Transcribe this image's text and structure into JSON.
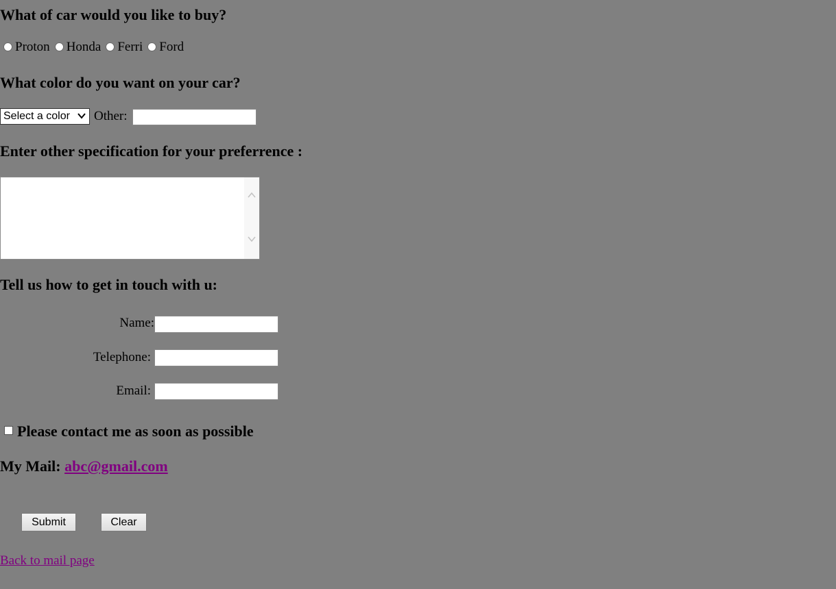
{
  "car_question": {
    "heading": "What of car would you like to buy?",
    "options": [
      "Proton",
      "Honda",
      "Ferri",
      "Ford"
    ]
  },
  "color_question": {
    "heading": "What color do you want on your car?",
    "select_value": "Select a color",
    "other_label": "Other:",
    "other_value": ""
  },
  "spec_question": {
    "heading": "Enter other specification for your preferrence :",
    "value": ""
  },
  "contact": {
    "heading": "Tell us how to get in touch with u:",
    "name_label": "Name:",
    "telephone_label": "Telephone:",
    "email_label": "Email:",
    "checkbox_label": "Please contact me as soon as possible",
    "checkbox_checked": false
  },
  "mail": {
    "label": "My Mail:",
    "address": "abc@gmail.com"
  },
  "buttons": {
    "submit": "Submit",
    "clear": "Clear"
  },
  "back_link": "Back to mail page",
  "colors": {
    "background": "#808080",
    "link_visited": "#800080"
  }
}
